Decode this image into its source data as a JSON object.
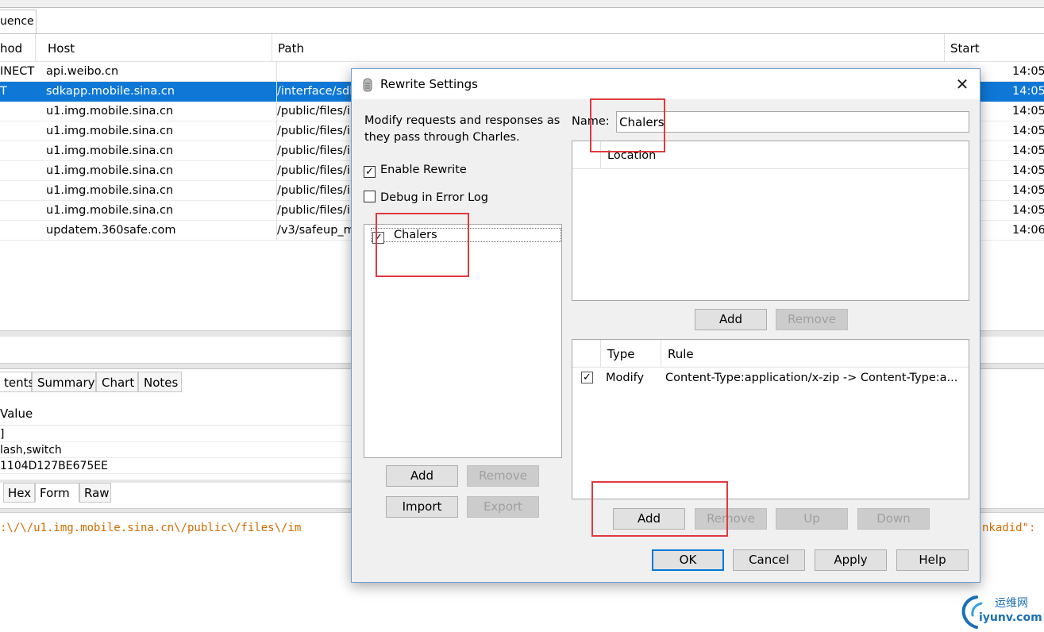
{
  "bg": {
    "sequence_tab": "uence",
    "columns": {
      "method": "hod",
      "host": "Host",
      "path": "Path",
      "start": "Start"
    },
    "rows": [
      {
        "method": "INECT",
        "host": "api.weibo.cn",
        "path": "",
        "start": "14:05"
      },
      {
        "method": "T",
        "host": "sdkapp.mobile.sina.cn",
        "path": "/interface/sdl",
        "start": "14:05"
      },
      {
        "method": "",
        "host": "u1.img.mobile.sina.cn",
        "path": "/public/files/i",
        "start": "14:05"
      },
      {
        "method": "",
        "host": "u1.img.mobile.sina.cn",
        "path": "/public/files/i",
        "start": "14:05"
      },
      {
        "method": "",
        "host": "u1.img.mobile.sina.cn",
        "path": "/public/files/i",
        "start": "14:05"
      },
      {
        "method": "",
        "host": "u1.img.mobile.sina.cn",
        "path": "/public/files/i",
        "start": "14:05"
      },
      {
        "method": "",
        "host": "u1.img.mobile.sina.cn",
        "path": "/public/files/i",
        "start": "14:05"
      },
      {
        "method": "",
        "host": "u1.img.mobile.sina.cn",
        "path": "/public/files/i",
        "start": "14:05"
      },
      {
        "method": "",
        "host": "updatem.360safe.com",
        "path": "/v3/safeup_m",
        "start": "14:06"
      }
    ],
    "bottom_tabs": [
      "tents",
      "Summary",
      "Chart",
      "Notes"
    ],
    "kv_header": "Value",
    "kv_rows": [
      "]",
      "lash,switch",
      "1104D127BE675EE"
    ],
    "view_tabs": [
      "Hex",
      "Form",
      "Raw"
    ],
    "code_left": ":\\/\\/u1.img.mobile.sina.cn\\/public\\/files\\/im",
    "code_right": "nkadid\":"
  },
  "dialog": {
    "title": "Rewrite Settings",
    "close_symbol": "✕",
    "intro": "Modify requests and responses as they pass through Charles.",
    "enable_rewrite": "Enable Rewrite",
    "enable_rewrite_checked": true,
    "debug_log": "Debug in Error Log",
    "debug_log_checked": false,
    "rules": [
      {
        "name": "Chalers",
        "checked": true
      }
    ],
    "left_buttons": {
      "add": "Add",
      "remove": "Remove",
      "import": "Import",
      "export": "Export"
    },
    "name_label": "Name:",
    "name_value": "Chalers",
    "location_header": "Location",
    "location_buttons": {
      "add": "Add",
      "remove": "Remove"
    },
    "rules_columns": {
      "type": "Type",
      "rule": "Rule"
    },
    "rule_rows": [
      {
        "checked": true,
        "type": "Modify",
        "rule": "Content-Type:application/x-zip -> Content-Type:a..."
      }
    ],
    "rule_buttons": {
      "add": "Add",
      "remove": "Remove",
      "up": "Up",
      "down": "Down"
    },
    "footer_buttons": {
      "ok": "OK",
      "cancel": "Cancel",
      "apply": "Apply",
      "help": "Help"
    }
  },
  "watermark": {
    "cn": "运维网",
    "en": "iyunv.com"
  },
  "colors": {
    "selection": "#0f78d7",
    "highlight": "#e0393e",
    "code": "#d26c00",
    "accent": "#0078d7"
  }
}
